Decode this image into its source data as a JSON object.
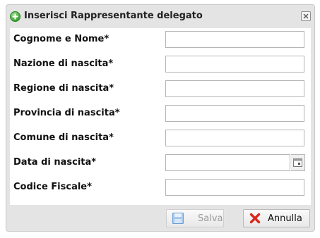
{
  "dialog": {
    "title": "Inserisci Rappresentante delegato",
    "title_icon": "add-circle-icon",
    "close_icon": "close-icon"
  },
  "form": {
    "fields": [
      {
        "label": "Cognome e Nome*",
        "value": ""
      },
      {
        "label": "Nazione di nascita*",
        "value": ""
      },
      {
        "label": "Regione di nascita*",
        "value": ""
      },
      {
        "label": "Provincia di nascita*",
        "value": ""
      },
      {
        "label": "Comune di nascita*",
        "value": ""
      },
      {
        "label": "Data di nascita*",
        "value": "",
        "icon": "calendar-icon"
      },
      {
        "label": "Codice Fiscale*",
        "value": ""
      }
    ]
  },
  "footer": {
    "save_label": "Salva",
    "save_icon": "floppy-disk-icon",
    "save_disabled": true,
    "cancel_label": "Annulla",
    "cancel_icon": "red-x-icon"
  },
  "colors": {
    "accent": "#3fa338",
    "cancel_icon": "#d9261c",
    "save_icon": "#6a9fd6"
  }
}
